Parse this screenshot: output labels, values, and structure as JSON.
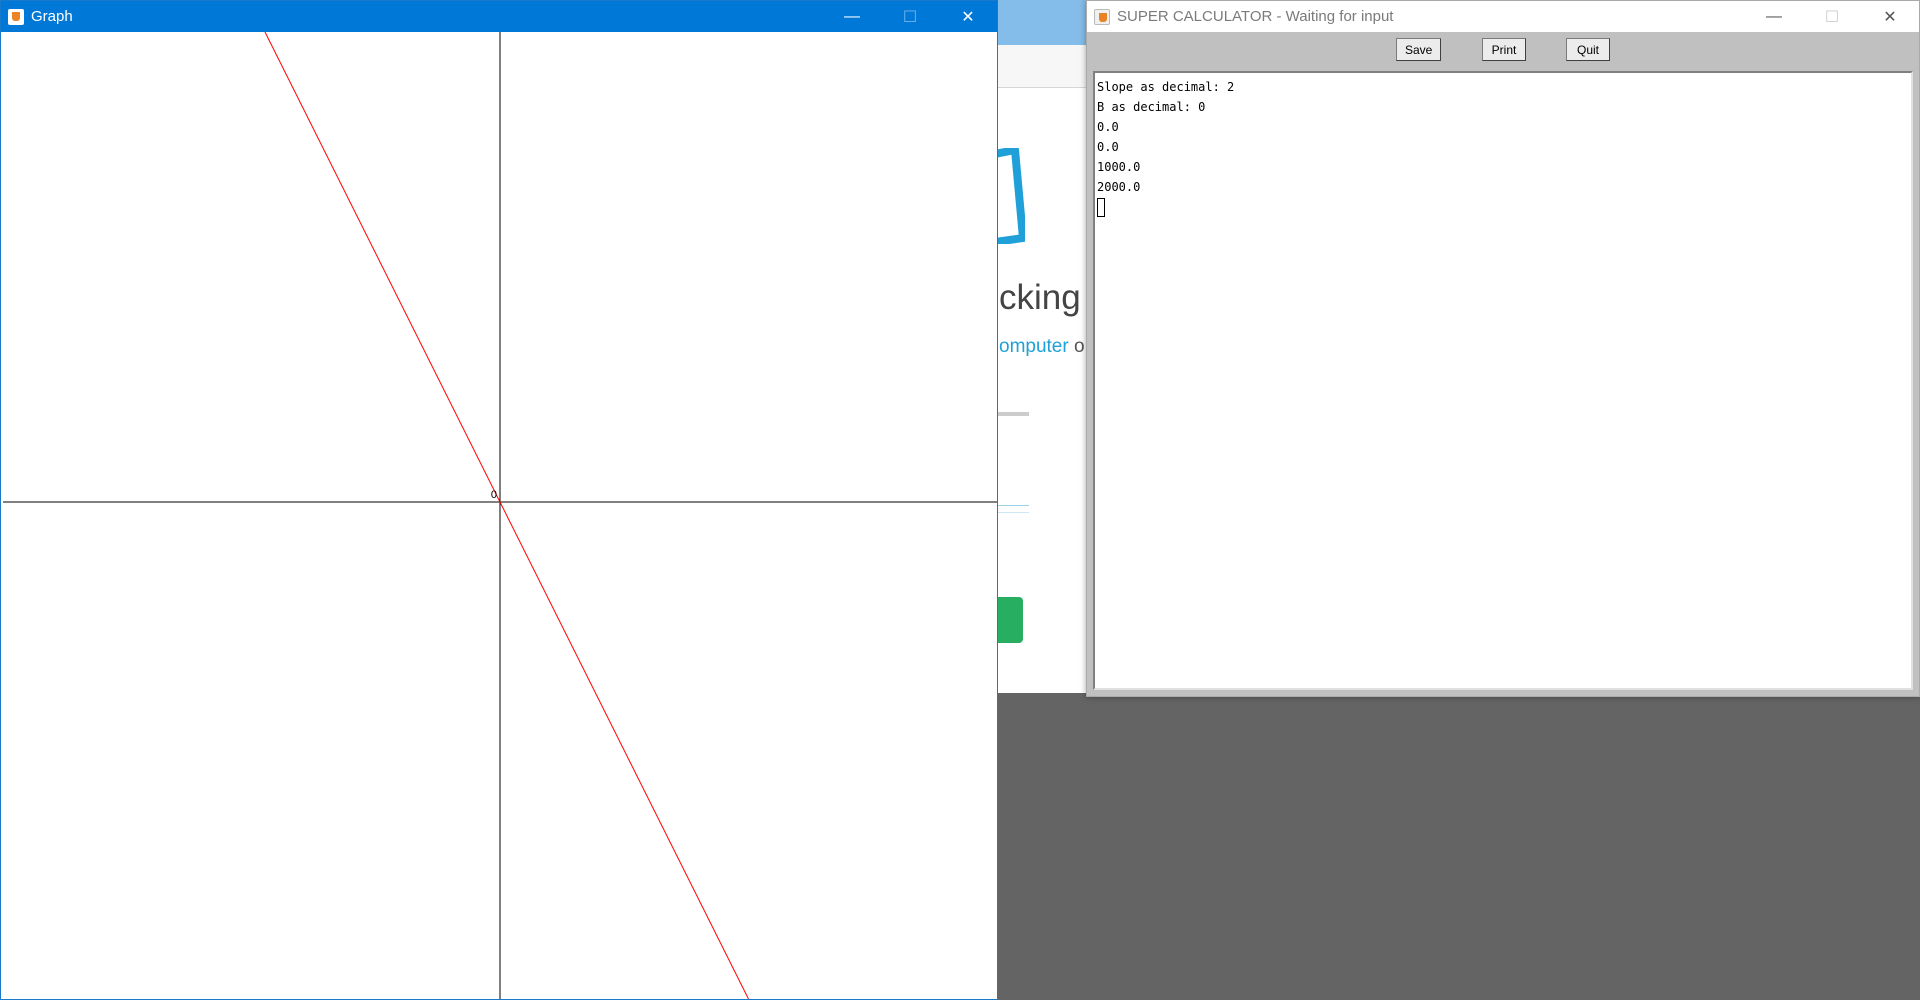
{
  "background_page": {
    "heading_fragment": "cking",
    "link_fragment": "omputer",
    "link_rest": " o"
  },
  "graph_window": {
    "title": "Graph",
    "controls": {
      "minimize": "—",
      "maximize": "☐",
      "close": "✕"
    },
    "origin_label": "0",
    "colors": {
      "axis": "#000000",
      "line": "#ff0000"
    },
    "line": {
      "slope": -2,
      "intercept": 0
    }
  },
  "calc_window": {
    "title": "SUPER CALCULATOR - Waiting for input",
    "controls": {
      "minimize": "—",
      "maximize": "☐",
      "close": "✕"
    },
    "buttons": {
      "save": "Save",
      "print": "Print",
      "quit": "Quit"
    },
    "output_lines": [
      "Slope as decimal: 2",
      "B as decimal: 0",
      "0.0",
      "0.0",
      "1000.0",
      "2000.0"
    ]
  }
}
